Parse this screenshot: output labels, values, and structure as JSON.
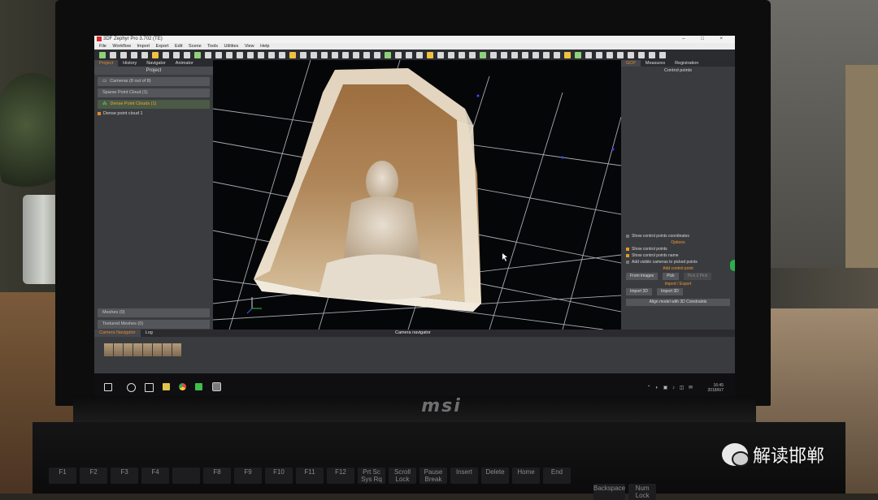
{
  "app": {
    "title": "3DF Zephyr Pro 3.702 (TE)",
    "window_controls": "– □ ×",
    "menu": [
      "File",
      "Workflow",
      "Import",
      "Export",
      "Edit",
      "Scene",
      "Tools",
      "Utilities",
      "View",
      "Help"
    ]
  },
  "left_panel": {
    "tabs": [
      "Project",
      "History",
      "Navigator",
      "Animator"
    ],
    "active_tab": "Project",
    "header": "Project",
    "items": [
      {
        "label": "Cameras (8 out of 8)"
      },
      {
        "label": "Sparse Point Cloud (1)"
      },
      {
        "label": "Dense Point Clouds (1)"
      }
    ],
    "subitem": "Dense point cloud 1",
    "bottom_items": [
      "Meshes (0)",
      "Textured Meshes (0)"
    ]
  },
  "right_panel": {
    "tabs": [
      "GCP",
      "Measures",
      "Registration"
    ],
    "active_tab": "GCP",
    "title": "Control points",
    "show_coords": "Show control points coordinates",
    "options_title": "Options",
    "options": [
      "Show control points",
      "Show control points name",
      "Add visible cameras to picked points"
    ],
    "add_title": "Add control point",
    "add_buttons": [
      "From images",
      "Pick",
      "Pick 2 Pick"
    ],
    "import_export_title": "Import / Export",
    "import_buttons": [
      "Import 3D",
      "Import 3D"
    ],
    "align_button": "Align model with 3D Constraints"
  },
  "bottom_panel": {
    "tabs": [
      "Camera Navigator",
      "Log"
    ],
    "active_tab": "Camera Navigator",
    "title": "Camera navigator"
  },
  "taskbar": {
    "time": "16:45",
    "date": "2018/6/7"
  },
  "laptop": {
    "brand": "msi",
    "keys_row1": [
      "F1",
      "F2",
      "F3",
      "F4",
      "",
      "F8",
      "F9",
      "F10",
      "F11",
      "F12",
      "Prt Sc\nSys Rq",
      "Scroll\nLock",
      "Pause\nBreak",
      "Insert",
      "Delete",
      "Home",
      "End"
    ],
    "keys_row2": [
      "Backspace",
      "Num\nLock"
    ]
  },
  "watermark": {
    "text": "解读邯郸"
  },
  "colors": {
    "accent": "#e48a2a",
    "panel": "#3b3c40",
    "viewport": "#050608",
    "grid": "#cfd3da"
  }
}
